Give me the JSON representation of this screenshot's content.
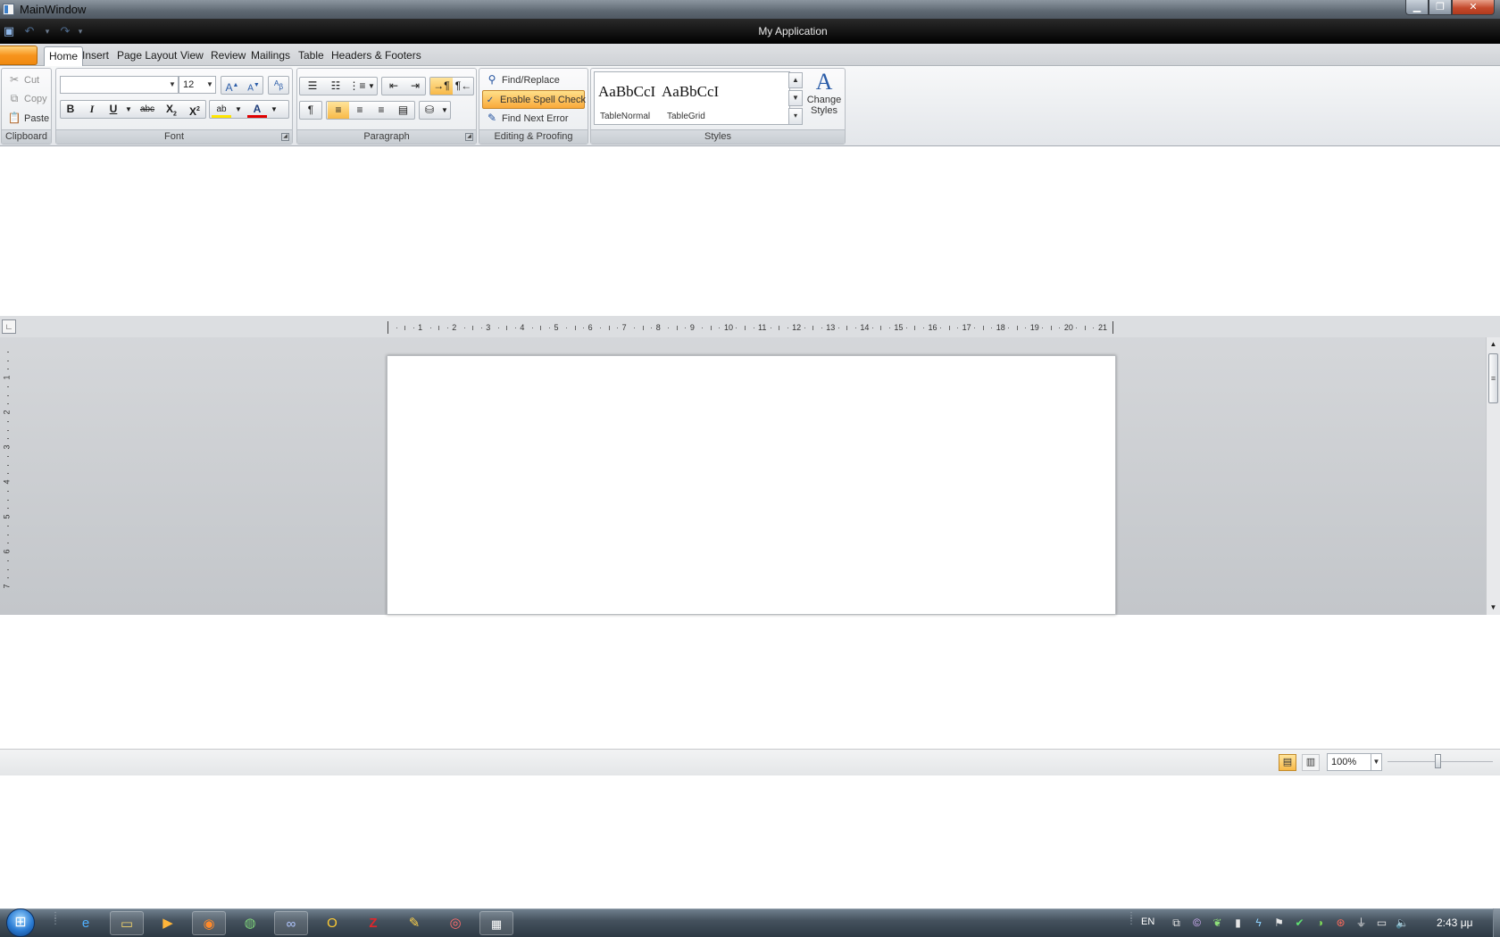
{
  "outer_window": {
    "title": "MainWindow"
  },
  "app": {
    "title": "My Application"
  },
  "ribbon": {
    "tabs": [
      "Home",
      "Insert",
      "Page Layout",
      "View",
      "Review",
      "Mailings",
      "Table",
      "Headers & Footers"
    ],
    "selected_tab": "Home",
    "clipboard": {
      "label": "Clipboard",
      "cut": "Cut",
      "copy": "Copy",
      "paste": "Paste"
    },
    "font": {
      "label": "Font",
      "font_name": "",
      "font_size": "12"
    },
    "paragraph": {
      "label": "Paragraph"
    },
    "editing": {
      "label": "Editing & Proofing",
      "find_replace": "Find/Replace",
      "spell_check": "Enable Spell Check",
      "find_next_error": "Find Next Error"
    },
    "styles": {
      "label": "Styles",
      "samples": [
        {
          "sample": "AaBbCcI",
          "name": "TableNormal"
        },
        {
          "sample": "AaBbCcI",
          "name": "TableGrid"
        }
      ],
      "change_styles": "Change Styles"
    }
  },
  "ruler": {
    "horizontal_numbers": [
      "1",
      "2",
      "3",
      "4",
      "5",
      "6",
      "7",
      "8",
      "9",
      "10",
      "11",
      "12",
      "13",
      "14",
      "15",
      "16",
      "17",
      "18",
      "19",
      "20",
      "21"
    ],
    "vertical_numbers": [
      "1",
      "2",
      "3",
      "4",
      "5",
      "6",
      "7"
    ]
  },
  "status_bar": {
    "zoom": "100%"
  },
  "taskbar": {
    "language": "EN",
    "clock": "2:43 μμ"
  },
  "colors": {
    "accent": "#f7941d",
    "ribbon_bg": "#e3e6ea",
    "workspace_bg": "#c9cbce",
    "taskbar_bg": "#3b4651"
  }
}
